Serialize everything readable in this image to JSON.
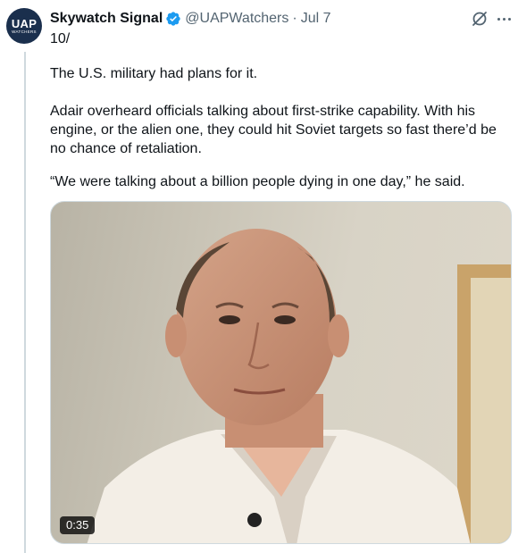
{
  "author": {
    "display_name": "Skywatch Signal",
    "handle": "@UAPWatchers",
    "separator": "·",
    "date": "Jul 7",
    "avatar_text": "UAP",
    "avatar_subtext": "WATCHERS",
    "verified": true
  },
  "tweet": {
    "thread_number": "10/",
    "paragraphs": [
      "The U.S. military had plans for it.",
      "Adair overheard officials talking about first-strike capability. With his engine, or the alien one, they could hit Soviet targets so fast there’d be no chance of retaliation.",
      "“We were talking about a billion people dying in one day,” he said."
    ]
  },
  "video": {
    "duration": "0:35"
  },
  "icons": {
    "verified": "verified-badge-icon",
    "grok": "grok-icon",
    "more": "more-options-icon"
  },
  "colors": {
    "verified_badge": "#1d9bf0",
    "secondary_text": "#536471",
    "thread_line": "#cfd9de"
  }
}
